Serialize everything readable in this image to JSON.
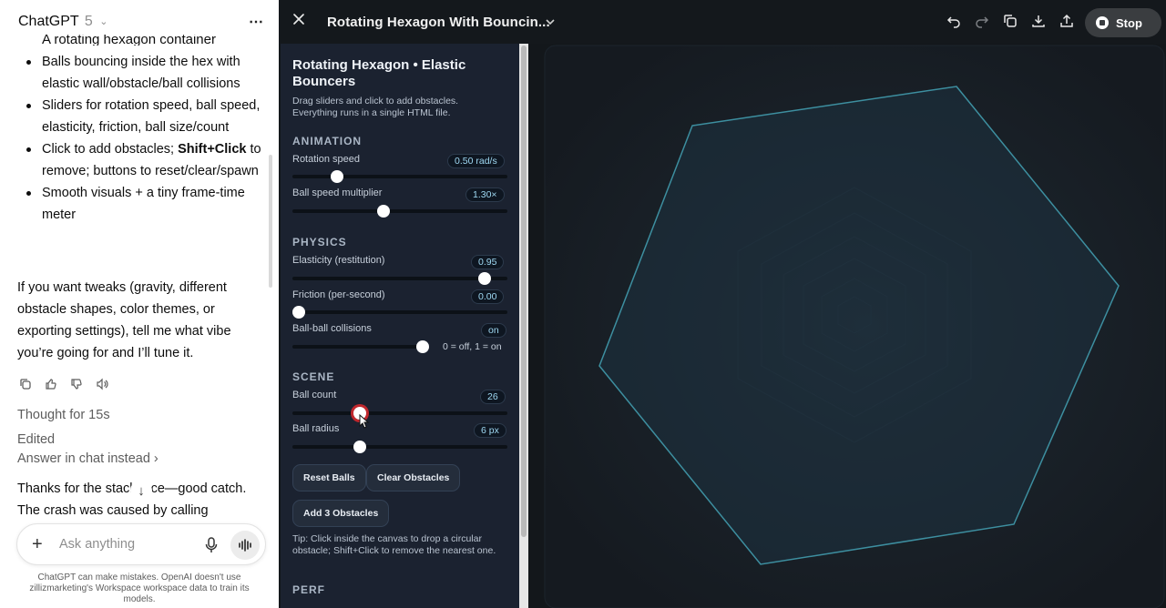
{
  "chat": {
    "title": "ChatGPT",
    "version": "5",
    "more_icon": "more-horizontal-icon",
    "clipped_line": "A rotating hexagon container",
    "bullets": [
      "Balls bouncing inside the hex with elastic wall/obstacle/ball collisions",
      "Sliders for rotation speed, ball speed, elasticity, friction, ball size/count",
      "Click to add obstacles; Shift+Click to remove; buttons to reset/clear/spawn",
      "Smooth visuals + a tiny frame-time meter"
    ],
    "bullet3_bold": "Shift+Click",
    "bullet3_pre": "Click to add obstacles; ",
    "bullet3_post": " to remove; buttons to reset/clear/spawn",
    "followup": "If you want tweaks (gravity, different obstacle shapes, color themes, or exporting settings), tell me what vibe you’re going for and I’ll tune it.",
    "thought": "Thought for 15s",
    "edited": "Edited",
    "answer_in_chat": "Answer in chat instead",
    "reply_line1": "Thanks for the stack",
    "reply_line1b": "ce—good catch.",
    "reply_line2": "The crash was caused by calling",
    "composer_placeholder": "Ask anything",
    "disclaimer": "ChatGPT can make mistakes. OpenAI doesn't use zillizmarketing's Workspace workspace data to train its models."
  },
  "canvas": {
    "title": "Rotating Hexagon With Bouncin...",
    "stop_label": "Stop",
    "icons": [
      "undo-icon",
      "redo-icon",
      "copy-icon",
      "download-icon",
      "share-icon"
    ]
  },
  "panel": {
    "title": "Rotating Hexagon • Elastic Bouncers",
    "desc": "Drag sliders and click to add obstacles. Everything runs in a single HTML file.",
    "sections": {
      "animation": "ANIMATION",
      "physics": "PHYSICS",
      "scene": "SCENE",
      "perf": "PERF"
    },
    "sliders": {
      "rotation": {
        "label": "Rotation speed",
        "value": "0.50 rad/s",
        "level": 0.19
      },
      "ball_speed": {
        "label": "Ball speed multiplier",
        "value": "1.30×",
        "level": 0.42
      },
      "elasticity": {
        "label": "Elasticity (restitution)",
        "value": "0.95",
        "level": 0.92
      },
      "friction": {
        "label": "Friction (per-second)",
        "value": "0.00",
        "level": 0.0
      },
      "collisions": {
        "label": "Ball-ball collisions",
        "value": "on",
        "level": 1.0,
        "hint": "0 = off, 1 = on"
      },
      "ball_count": {
        "label": "Ball count",
        "value": "26",
        "level": 0.3
      },
      "ball_radius": {
        "label": "Ball radius",
        "value": "6 px",
        "level": 0.3
      }
    },
    "buttons": {
      "reset": "Reset Balls",
      "clear": "Clear Obstacles",
      "add": "Add 3 Obstacles"
    },
    "tip": "Tip: Click inside the canvas to drop a circular obstacle; Shift+Click to remove the nearest one."
  },
  "colors": {
    "accent_ring": "#c0272d",
    "hex_stroke": "#3d8fa0",
    "pill_text": "#9ed8f2"
  }
}
